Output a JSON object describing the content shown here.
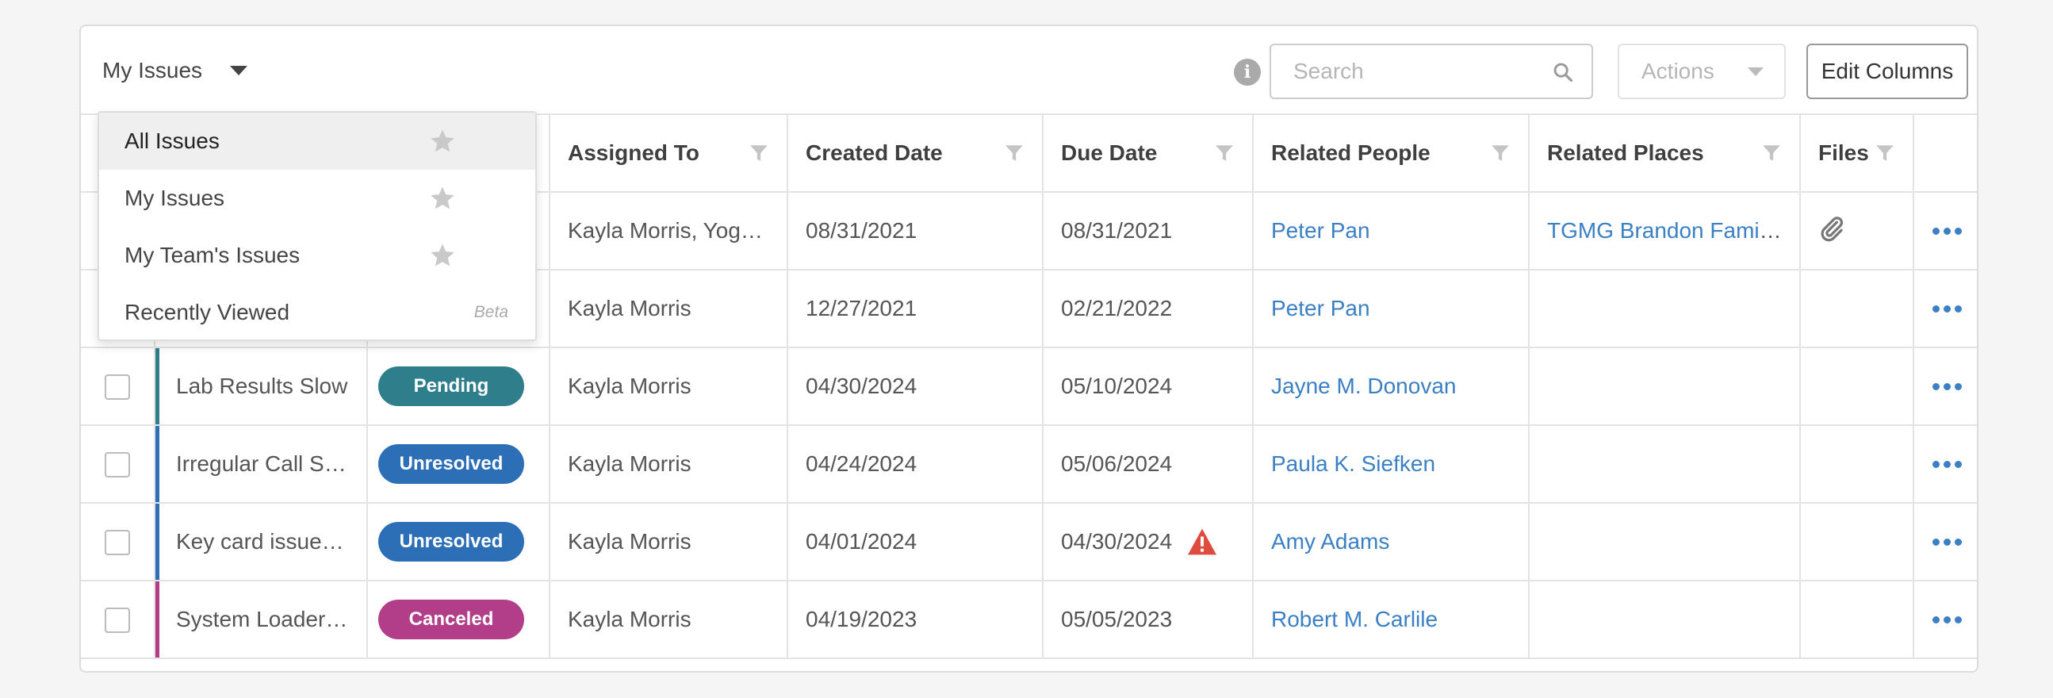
{
  "toolbar": {
    "view_label": "My Issues",
    "search_placeholder": "Search",
    "actions_label": "Actions",
    "edit_columns_label": "Edit Columns"
  },
  "dropdown": {
    "items": [
      {
        "label": "All Issues",
        "active": true,
        "star": true
      },
      {
        "label": "My Issues",
        "active": false,
        "star": true
      },
      {
        "label": "My Team's Issues",
        "active": false,
        "star": true
      },
      {
        "label": "Recently Viewed",
        "active": false,
        "tag": "Beta"
      }
    ]
  },
  "columns": {
    "assigned": "Assigned To",
    "created": "Created Date",
    "due": "Due Date",
    "people": "Related People",
    "places": "Related Places",
    "files": "Files"
  },
  "status_colors": {
    "Pending": "#2f7e8c",
    "Unresolved": "#2c6fb6",
    "Canceled": "#b23e8a"
  },
  "rows": [
    {
      "subject": "",
      "status": "",
      "assigned": "Kayla Morris, Yoge…",
      "created": "08/31/2021",
      "due": "08/31/2021",
      "people": "Peter Pan",
      "places": "TGMG Brandon Famil…",
      "files": "paperclip-icon",
      "overdue": false
    },
    {
      "subject": "",
      "status": "",
      "assigned": "Kayla Morris",
      "created": "12/27/2021",
      "due": "02/21/2022",
      "people": "Peter Pan",
      "places": "",
      "files": "",
      "overdue": false
    },
    {
      "subject": "Lab Results Slow",
      "status": "Pending",
      "assigned": "Kayla Morris",
      "created": "04/30/2024",
      "due": "05/10/2024",
      "people": "Jayne M. Donovan",
      "places": "",
      "files": "",
      "overdue": false
    },
    {
      "subject": "Irregular Call Sc…",
      "status": "Unresolved",
      "assigned": "Kayla Morris",
      "created": "04/24/2024",
      "due": "05/06/2024",
      "people": "Paula K. Siefken",
      "places": "",
      "files": "",
      "overdue": false
    },
    {
      "subject": "Key card issues …",
      "status": "Unresolved",
      "assigned": "Kayla Morris",
      "created": "04/01/2024",
      "due": "04/30/2024",
      "people": "Amy Adams",
      "places": "",
      "files": "",
      "overdue": true
    },
    {
      "subject": "System Loader i…",
      "status": "Canceled",
      "assigned": "Kayla Morris",
      "created": "04/19/2023",
      "due": "05/05/2023",
      "people": "Robert M. Carlile",
      "places": "",
      "files": "",
      "overdue": false
    }
  ]
}
